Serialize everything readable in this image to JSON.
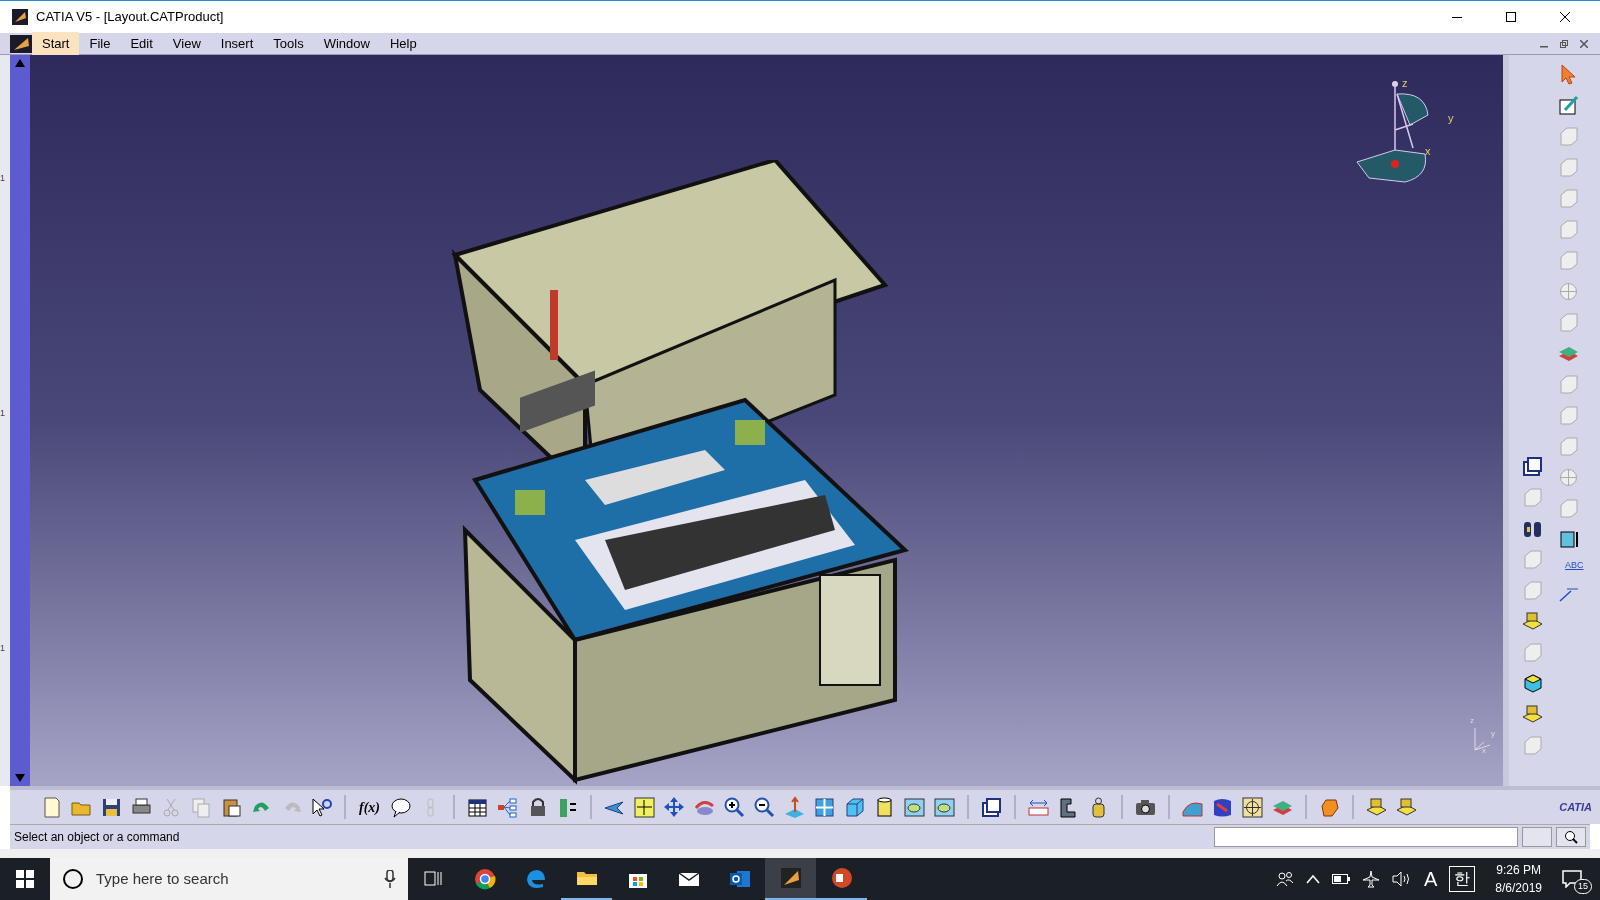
{
  "window": {
    "title": "CATIA V5 - [Layout.CATProduct]"
  },
  "menu": [
    {
      "label": "Start",
      "selected": true
    },
    {
      "label": "File",
      "selected": false
    },
    {
      "label": "Edit",
      "selected": false
    },
    {
      "label": "View",
      "selected": false
    },
    {
      "label": "Insert",
      "selected": false
    },
    {
      "label": "Tools",
      "selected": false
    },
    {
      "label": "Window",
      "selected": false
    },
    {
      "label": "Help",
      "selected": false
    }
  ],
  "viewport": {
    "compass_labels": [
      "z",
      "y",
      "x"
    ],
    "axis_labels": [
      "z",
      "y",
      "x"
    ],
    "ruler_marks": [
      "1",
      "1",
      "1"
    ],
    "right_toolbar_label": "ABC"
  },
  "toolbar": {
    "formula_label": "f(x)",
    "logo": "CATIA"
  },
  "status_bar": {
    "message": "Select an object or a command"
  },
  "taskbar": {
    "search_placeholder": "Type here to search",
    "input_indicator": "A",
    "language": "한",
    "time": "9:26 PM",
    "date": "8/6/2019",
    "notifications": "15"
  }
}
